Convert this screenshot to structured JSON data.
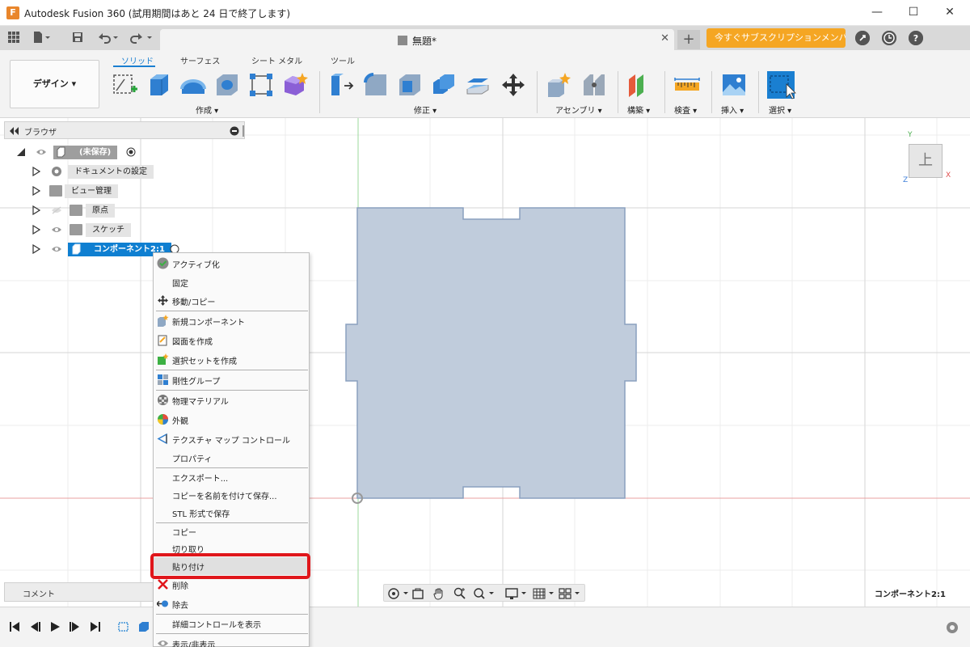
{
  "window": {
    "logo_letter": "F",
    "title": "Autodesk Fusion 360 (試用期間はあと 24 日で終了します)",
    "minimize": "—",
    "maximize": "☐",
    "close": "✕"
  },
  "tabs": {
    "doc_title": "無題*",
    "close": "✕",
    "new_tab": "+",
    "subscribe_label": "今すぐサブスクリプションメンバーに..."
  },
  "ribbon": {
    "workspace": "デザイン ▾",
    "tabs": [
      "ソリッド",
      "サーフェス",
      "シート メタル",
      "ツール"
    ],
    "groups": [
      "作成 ▾",
      "修正 ▾",
      "アセンブリ ▾",
      "構築 ▾",
      "検査 ▾",
      "挿入 ▾",
      "選択 ▾"
    ]
  },
  "browser": {
    "title": "ブラウザ",
    "root_label": "(未保存)",
    "items": [
      "ドキュメントの設定",
      "ビュー管理",
      "原点",
      "スケッチ",
      "コンポーネント2:1"
    ]
  },
  "comment": {
    "label": "コメント"
  },
  "viewcube": {
    "face": "上",
    "axis_y": "Y",
    "axis_x": "X",
    "axis_z": "Z"
  },
  "status": {
    "component": "コンポーネント2:1"
  },
  "context_menu": {
    "items": [
      "アクティブ化",
      "固定",
      "移動/コピー",
      "新規コンポーネント",
      "図面を作成",
      "選択セットを作成",
      "剛性グループ",
      "物理マテリアル",
      "外観",
      "テクスチャ マップ コントロール",
      "プロパティ",
      "エクスポート...",
      "コピーを名前を付けて保存...",
      "STL 形式で保存",
      "コピー",
      "切り取り",
      "貼り付け",
      "削除",
      "除去",
      "詳細コントロールを表示",
      "表示/非表示"
    ]
  },
  "colors": {
    "accent": "#1a7fd1",
    "subscribe": "#f5a623",
    "highlight": "#e0161b",
    "sketch_fill": "#c0ccdc",
    "sketch_stroke": "#8aa0bf"
  }
}
